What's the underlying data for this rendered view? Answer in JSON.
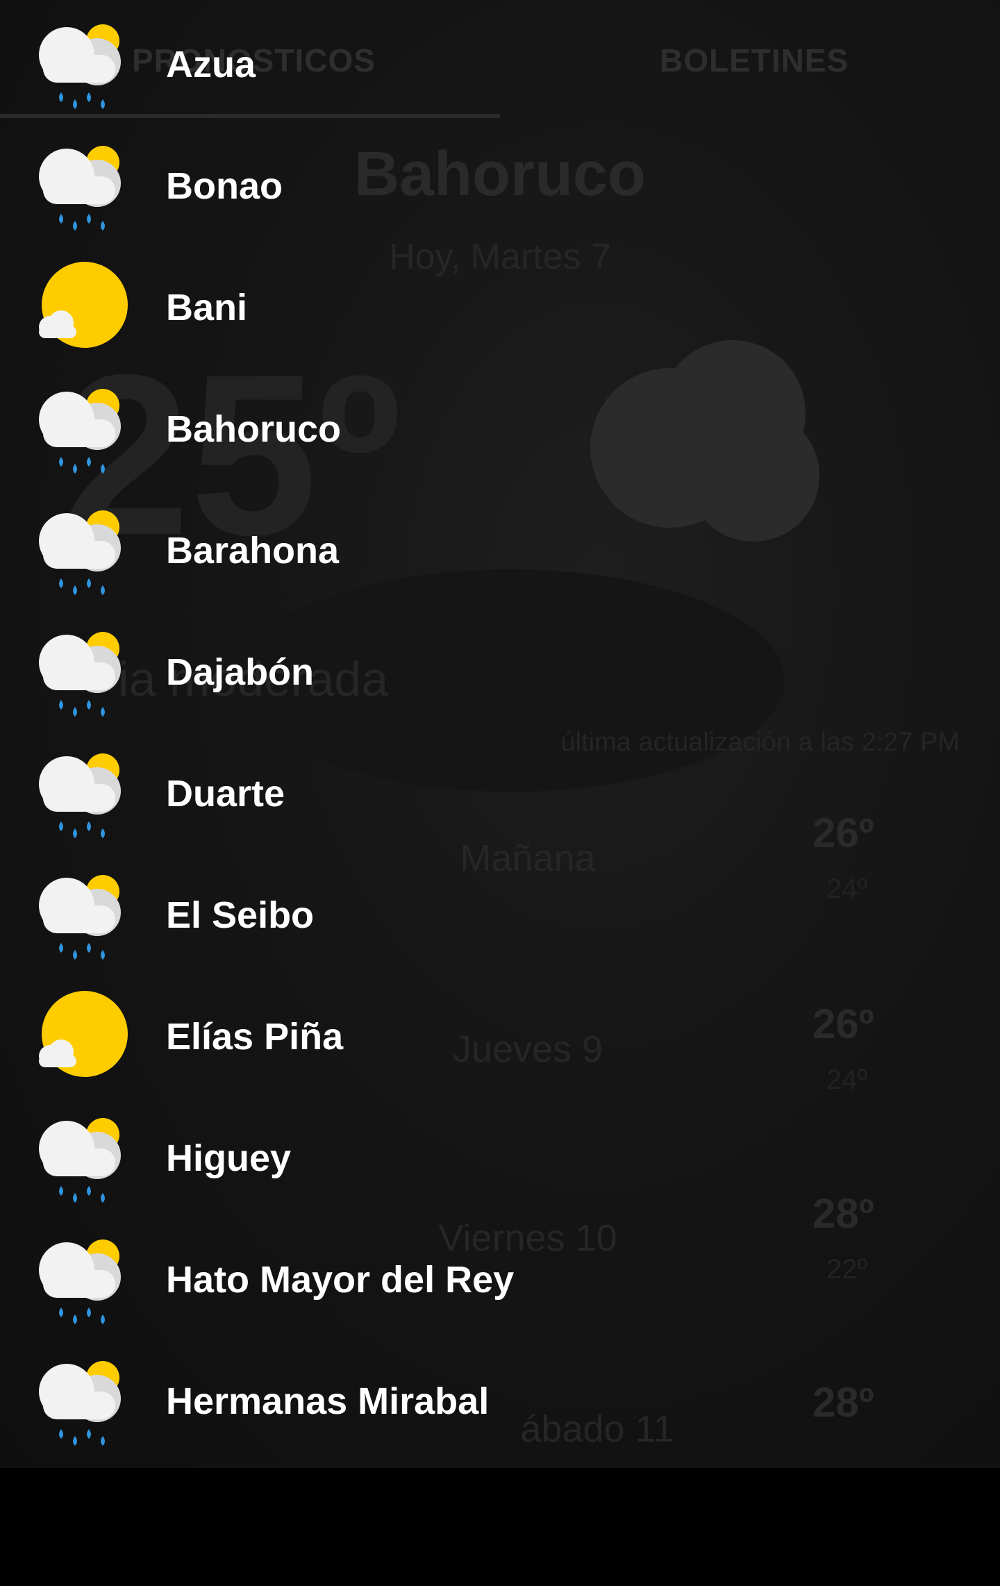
{
  "tabs": [
    {
      "label": "PRONOSTICOS",
      "selected": true
    },
    {
      "label": "BOLETINES",
      "selected": false
    }
  ],
  "background_screen": {
    "title": "Bahoruco",
    "date": "Hoy, Martes 7",
    "current_temp": "25º",
    "condition": "ia moderada",
    "last_updated": "última actualización a las 2:27 PM",
    "forecast": [
      {
        "day": "Mañana",
        "high": "26º",
        "low": "24º"
      },
      {
        "day": "Jueves 9",
        "high": "26º",
        "low": "24º"
      },
      {
        "day": "Viernes 10",
        "high": "28º",
        "low": "22º"
      },
      {
        "day": "ábado 11",
        "high": "28º",
        "low": ""
      }
    ]
  },
  "provinces": [
    {
      "name": "Azua",
      "icon": "partly-cloudy-rain-icon"
    },
    {
      "name": "Bonao",
      "icon": "partly-cloudy-rain-icon"
    },
    {
      "name": "Bani",
      "icon": "sunny-icon"
    },
    {
      "name": "Bahoruco",
      "icon": "partly-cloudy-rain-icon"
    },
    {
      "name": "Barahona",
      "icon": "partly-cloudy-rain-icon"
    },
    {
      "name": "Dajabón",
      "icon": "partly-cloudy-rain-icon"
    },
    {
      "name": "Duarte",
      "icon": "partly-cloudy-rain-icon"
    },
    {
      "name": "El Seibo",
      "icon": "partly-cloudy-rain-icon"
    },
    {
      "name": "Elías Piña",
      "icon": "sunny-icon"
    },
    {
      "name": "Higuey",
      "icon": "partly-cloudy-rain-icon"
    },
    {
      "name": "Hato Mayor del Rey",
      "icon": "partly-cloudy-rain-icon"
    },
    {
      "name": "Hermanas Mirabal",
      "icon": "partly-cloudy-rain-icon"
    }
  ],
  "colors": {
    "sun": "#FFCC00",
    "cloud": "#F2F2F2",
    "rain": "#2F95E0",
    "text": "#FFFFFF",
    "background": "#0D0D0D"
  }
}
